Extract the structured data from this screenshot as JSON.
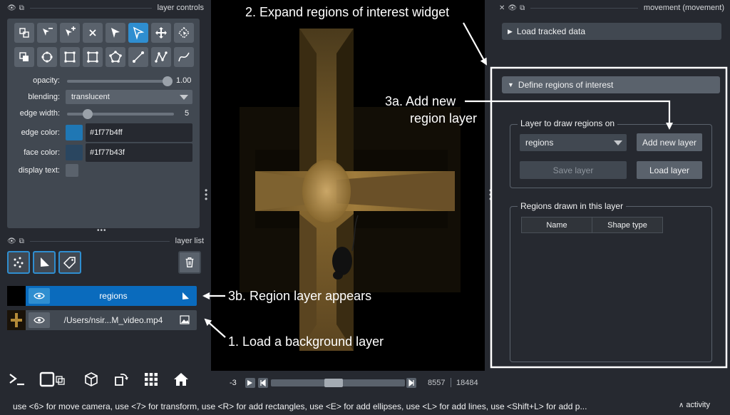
{
  "left_dock": {
    "controls_title": "layer controls",
    "labels": {
      "opacity": "opacity:",
      "blending": "blending:",
      "edge_width": "edge width:",
      "edge_color": "edge color:",
      "face_color": "face color:",
      "display_text": "display text:"
    },
    "opacity_value": "1.00",
    "opacity_fraction": 1.0,
    "blending_value": "translucent",
    "edge_width_value": "5",
    "edge_width_fraction": 0.16,
    "edge_color_hex": "#1f77b4ff",
    "face_color_hex": "#1f77b43f",
    "edge_swatch_color": "#1f77b4",
    "face_swatch_color": "#2a4660",
    "list_title": "layer list",
    "layers": [
      {
        "name": "regions",
        "selected": true
      },
      {
        "name": "/Users/nsir...M_video.mp4",
        "selected": false
      }
    ]
  },
  "canvas": {
    "frame_start": "-3",
    "frame_current": "8557",
    "frame_total": "18484",
    "frame_fraction": 0.463
  },
  "right_dock": {
    "title": "movement (movement)",
    "load_tracked_data": "Load tracked data",
    "define_roi": "Define regions of interest",
    "layer_group_title": "Layer to draw regions on",
    "layer_select_value": "regions",
    "add_new_layer": "Add new layer",
    "save_layer": "Save layer",
    "load_layer": "Load layer",
    "regions_group_title": "Regions drawn in this layer",
    "table_headers": [
      "Name",
      "Shape type"
    ]
  },
  "annotations": {
    "step2": "2. Expand regions of interest widget",
    "step3a_line1": "3a. Add new",
    "step3a_line2": "region layer",
    "step3b": "3b. Region layer appears",
    "step1": "1. Load a background layer"
  },
  "status_bar": {
    "text": "use <6> for move camera, use <7> for transform, use <R> for add rectangles, use <E> for add ellipses, use <L> for add lines, use <Shift+L> for add p...",
    "activity": "activity"
  }
}
